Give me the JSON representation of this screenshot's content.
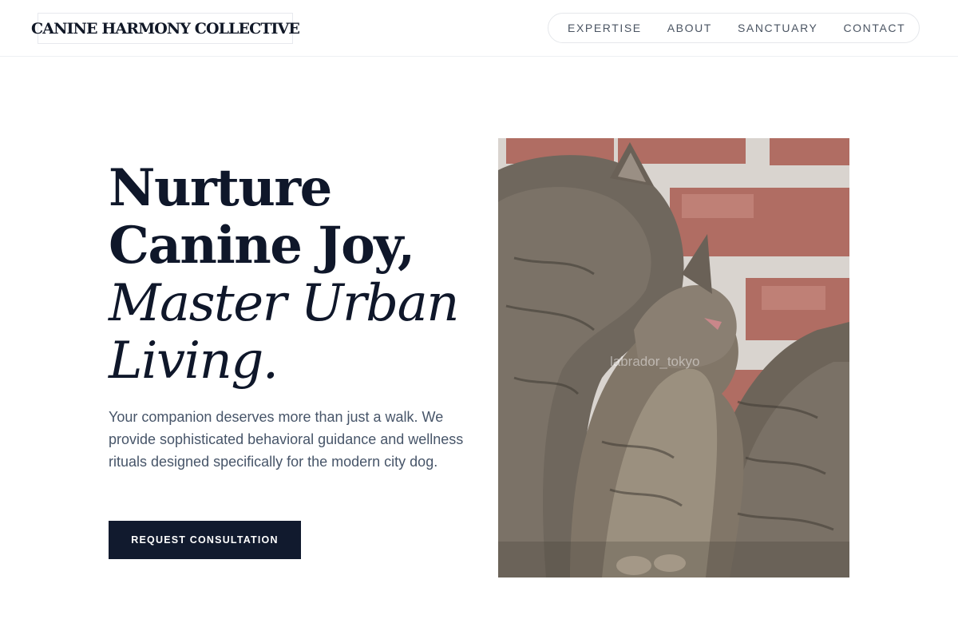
{
  "brand": {
    "name": "CANINE HARMONY COLLECTIVE"
  },
  "nav": {
    "items": [
      {
        "label": "EXPERTISE"
      },
      {
        "label": "ABOUT"
      },
      {
        "label": "SANCTUARY"
      },
      {
        "label": "CONTACT"
      }
    ]
  },
  "hero": {
    "title_line1": "Nurture",
    "title_line2": "Canine Joy,",
    "title_line3": "Master Urban",
    "title_line4": "Living.",
    "body": "Your companion deserves more than just a walk. We provide sophisticated behavioral guidance and wellness rituals designed specifically for the modern city dog.",
    "cta_label": "REQUEST CONSULTATION",
    "image_alt": "Two tabby cats cuddling in front of a red brick wall",
    "image_watermark": "labrador_tokyo"
  },
  "colors": {
    "primary": "#0f172a",
    "button_bg": "#111a2e",
    "body_text": "#475569",
    "nav_text": "#4b5563",
    "border": "#e5e7eb"
  }
}
